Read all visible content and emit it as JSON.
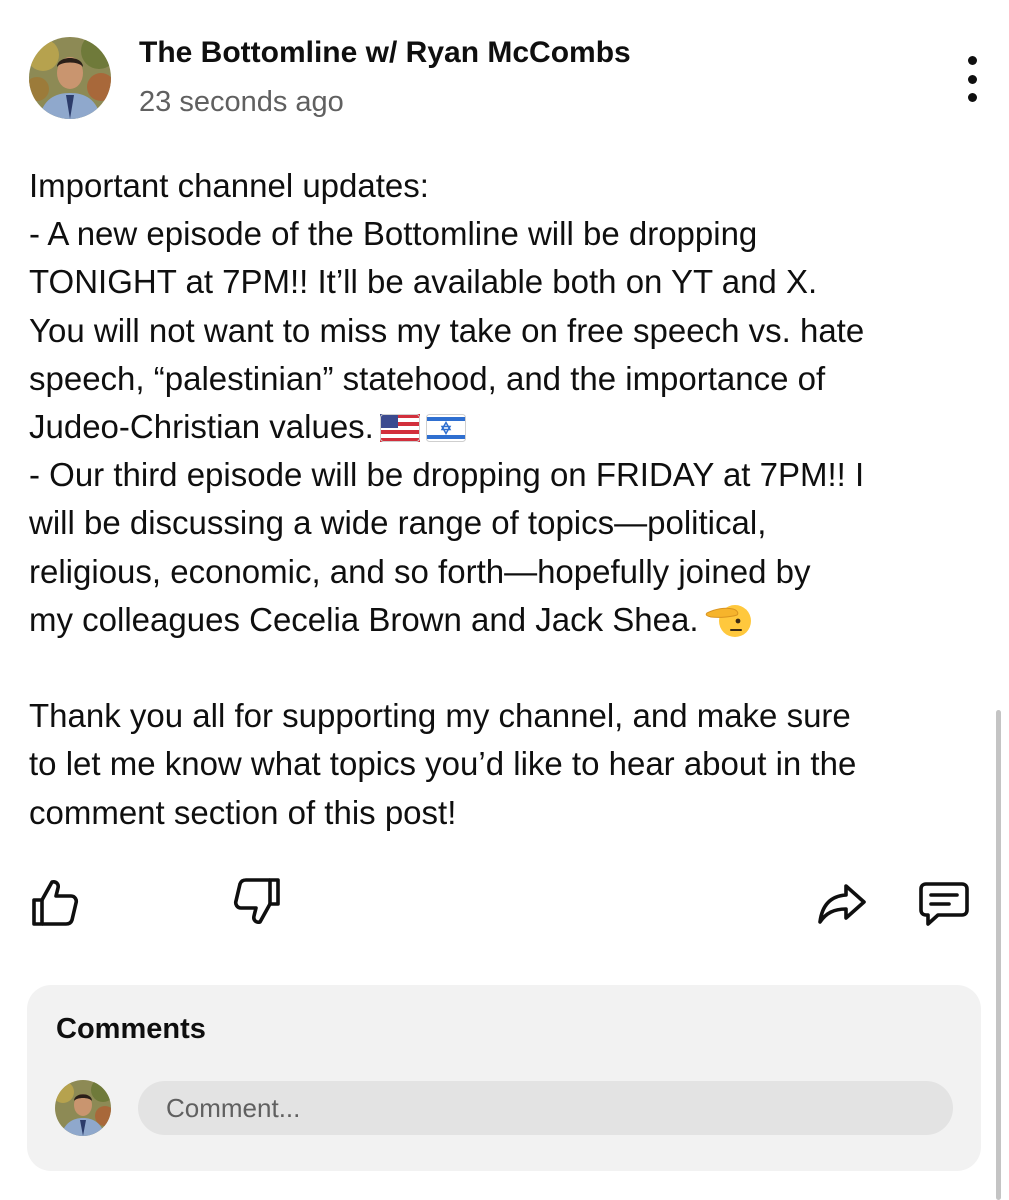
{
  "post": {
    "channel_name": "The Bottomline w/ Ryan McCombs",
    "timestamp": "23 seconds ago",
    "avatar_icon": "profile-photo",
    "more_icon": "more-vertical-icon",
    "lines": [
      "Important channel updates:",
      "- A new episode of the Bottomline will be dropping",
      "TONIGHT at 7PM!! It’ll be available both on YT and X.",
      "You will not want to miss my take on free speech vs. hate",
      "speech, “palestinian” statehood, and the importance of",
      "Judeo-Christian values.",
      "- Our third episode will be dropping on FRIDAY at 7PM!! I",
      "will be discussing a wide range of topics—political,",
      "religious, economic, and so forth—hopefully joined by",
      "my colleagues Cecelia Brown and Jack Shea."
    ],
    "closing_lines": [
      "Thank you all for supporting my channel, and make sure",
      "to let me know what topics you’d like to hear about in the",
      "comment section of this post!"
    ],
    "emoji": {
      "flags": [
        "us-flag-emoji",
        "israel-flag-emoji"
      ],
      "salute": "saluting-face-emoji"
    }
  },
  "actions": {
    "like_icon": "thumbs-up-icon",
    "dislike_icon": "thumbs-down-icon",
    "share_icon": "share-icon",
    "comment_icon": "comment-icon"
  },
  "comments": {
    "heading": "Comments",
    "placeholder": "Comment..."
  },
  "colors": {
    "text": "#0f0f0f",
    "secondary_text": "#606060",
    "card_bg": "#f2f2f2",
    "input_bg": "#e3e3e3"
  }
}
